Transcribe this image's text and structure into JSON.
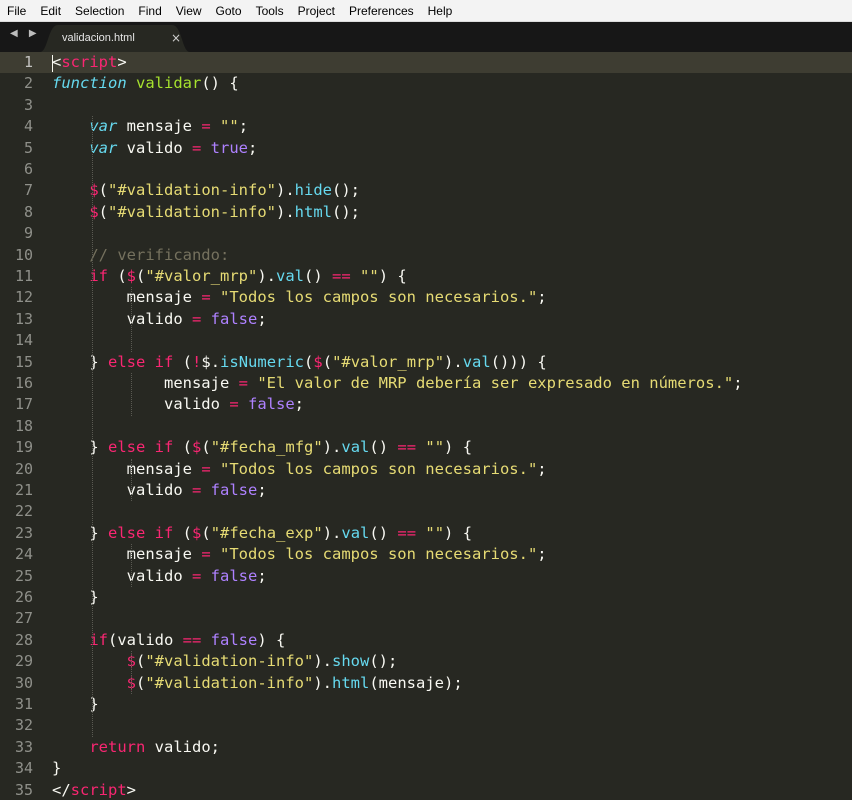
{
  "menu": [
    "File",
    "Edit",
    "Selection",
    "Find",
    "View",
    "Goto",
    "Tools",
    "Project",
    "Preferences",
    "Help"
  ],
  "tab": {
    "title": "validacion.html",
    "close": "×",
    "nav": "◀ ▶"
  },
  "colors": {
    "background": "#272822",
    "keyword": "#f92672",
    "storage": "#66d9ef",
    "function": "#a6e22e",
    "string": "#e6db74",
    "comment": "#75715e",
    "constant": "#ae81ff"
  },
  "editor": {
    "current_line": 1,
    "lines": [
      [
        [
          "p",
          "<"
        ],
        [
          "t",
          "script"
        ],
        [
          "p",
          ">"
        ]
      ],
      [
        [
          "st",
          "function"
        ],
        [
          "p",
          " "
        ],
        [
          "f",
          "validar"
        ],
        [
          "p",
          "() {"
        ]
      ],
      [],
      [
        [
          "p",
          "    "
        ],
        [
          "st",
          "var"
        ],
        [
          "p",
          " mensaje "
        ],
        [
          "k",
          "="
        ],
        [
          "p",
          " "
        ],
        [
          "s",
          "\"\""
        ],
        [
          "p",
          ";"
        ]
      ],
      [
        [
          "p",
          "    "
        ],
        [
          "st",
          "var"
        ],
        [
          "p",
          " valido "
        ],
        [
          "k",
          "="
        ],
        [
          "p",
          " "
        ],
        [
          "n",
          "true"
        ],
        [
          "p",
          ";"
        ]
      ],
      [],
      [
        [
          "p",
          "    "
        ],
        [
          "k",
          "$"
        ],
        [
          "p",
          "("
        ],
        [
          "s",
          "\"#validation-info\""
        ],
        [
          "p",
          ")."
        ],
        [
          "b",
          "hide"
        ],
        [
          "p",
          "();"
        ]
      ],
      [
        [
          "p",
          "    "
        ],
        [
          "k",
          "$"
        ],
        [
          "p",
          "("
        ],
        [
          "s",
          "\"#validation-info\""
        ],
        [
          "p",
          ")."
        ],
        [
          "b",
          "html"
        ],
        [
          "p",
          "();"
        ]
      ],
      [],
      [
        [
          "p",
          "    "
        ],
        [
          "c",
          "// verificando:"
        ]
      ],
      [
        [
          "p",
          "    "
        ],
        [
          "k",
          "if"
        ],
        [
          "p",
          " ("
        ],
        [
          "k",
          "$"
        ],
        [
          "p",
          "("
        ],
        [
          "s",
          "\"#valor_mrp\""
        ],
        [
          "p",
          ")."
        ],
        [
          "b",
          "val"
        ],
        [
          "p",
          "() "
        ],
        [
          "k",
          "=="
        ],
        [
          "p",
          " "
        ],
        [
          "s",
          "\"\""
        ],
        [
          "p",
          ") {"
        ]
      ],
      [
        [
          "p",
          "        mensaje "
        ],
        [
          "k",
          "="
        ],
        [
          "p",
          " "
        ],
        [
          "s",
          "\"Todos los campos son necesarios.\""
        ],
        [
          "p",
          ";"
        ]
      ],
      [
        [
          "p",
          "        valido "
        ],
        [
          "k",
          "="
        ],
        [
          "p",
          " "
        ],
        [
          "n",
          "false"
        ],
        [
          "p",
          ";"
        ]
      ],
      [],
      [
        [
          "p",
          "    } "
        ],
        [
          "k",
          "else"
        ],
        [
          "p",
          " "
        ],
        [
          "k",
          "if"
        ],
        [
          "p",
          " ("
        ],
        [
          "k",
          "!"
        ],
        [
          "p",
          "$."
        ],
        [
          "b",
          "isNumeric"
        ],
        [
          "p",
          "("
        ],
        [
          "k",
          "$"
        ],
        [
          "p",
          "("
        ],
        [
          "s",
          "\"#valor_mrp\""
        ],
        [
          "p",
          ")."
        ],
        [
          "b",
          "val"
        ],
        [
          "p",
          "())) {"
        ]
      ],
      [
        [
          "p",
          "            mensaje "
        ],
        [
          "k",
          "="
        ],
        [
          "p",
          " "
        ],
        [
          "s",
          "\"El valor de MRP debería ser expresado en números.\""
        ],
        [
          "p",
          ";"
        ]
      ],
      [
        [
          "p",
          "            valido "
        ],
        [
          "k",
          "="
        ],
        [
          "p",
          " "
        ],
        [
          "n",
          "false"
        ],
        [
          "p",
          ";"
        ]
      ],
      [],
      [
        [
          "p",
          "    } "
        ],
        [
          "k",
          "else"
        ],
        [
          "p",
          " "
        ],
        [
          "k",
          "if"
        ],
        [
          "p",
          " ("
        ],
        [
          "k",
          "$"
        ],
        [
          "p",
          "("
        ],
        [
          "s",
          "\"#fecha_mfg\""
        ],
        [
          "p",
          ")."
        ],
        [
          "b",
          "val"
        ],
        [
          "p",
          "() "
        ],
        [
          "k",
          "=="
        ],
        [
          "p",
          " "
        ],
        [
          "s",
          "\"\""
        ],
        [
          "p",
          ") {"
        ]
      ],
      [
        [
          "p",
          "        mensaje "
        ],
        [
          "k",
          "="
        ],
        [
          "p",
          " "
        ],
        [
          "s",
          "\"Todos los campos son necesarios.\""
        ],
        [
          "p",
          ";"
        ]
      ],
      [
        [
          "p",
          "        valido "
        ],
        [
          "k",
          "="
        ],
        [
          "p",
          " "
        ],
        [
          "n",
          "false"
        ],
        [
          "p",
          ";"
        ]
      ],
      [],
      [
        [
          "p",
          "    } "
        ],
        [
          "k",
          "else"
        ],
        [
          "p",
          " "
        ],
        [
          "k",
          "if"
        ],
        [
          "p",
          " ("
        ],
        [
          "k",
          "$"
        ],
        [
          "p",
          "("
        ],
        [
          "s",
          "\"#fecha_exp\""
        ],
        [
          "p",
          ")."
        ],
        [
          "b",
          "val"
        ],
        [
          "p",
          "() "
        ],
        [
          "k",
          "=="
        ],
        [
          "p",
          " "
        ],
        [
          "s",
          "\"\""
        ],
        [
          "p",
          ") {"
        ]
      ],
      [
        [
          "p",
          "        mensaje "
        ],
        [
          "k",
          "="
        ],
        [
          "p",
          " "
        ],
        [
          "s",
          "\"Todos los campos son necesarios.\""
        ],
        [
          "p",
          ";"
        ]
      ],
      [
        [
          "p",
          "        valido "
        ],
        [
          "k",
          "="
        ],
        [
          "p",
          " "
        ],
        [
          "n",
          "false"
        ],
        [
          "p",
          ";"
        ]
      ],
      [
        [
          "p",
          "    }"
        ]
      ],
      [],
      [
        [
          "p",
          "    "
        ],
        [
          "k",
          "if"
        ],
        [
          "p",
          "(valido "
        ],
        [
          "k",
          "=="
        ],
        [
          "p",
          " "
        ],
        [
          "n",
          "false"
        ],
        [
          "p",
          ") {"
        ]
      ],
      [
        [
          "p",
          "        "
        ],
        [
          "k",
          "$"
        ],
        [
          "p",
          "("
        ],
        [
          "s",
          "\"#validation-info\""
        ],
        [
          "p",
          ")."
        ],
        [
          "b",
          "show"
        ],
        [
          "p",
          "();"
        ]
      ],
      [
        [
          "p",
          "        "
        ],
        [
          "k",
          "$"
        ],
        [
          "p",
          "("
        ],
        [
          "s",
          "\"#validation-info\""
        ],
        [
          "p",
          ")."
        ],
        [
          "b",
          "html"
        ],
        [
          "p",
          "(mensaje);"
        ]
      ],
      [
        [
          "p",
          "    }"
        ]
      ],
      [],
      [
        [
          "p",
          "    "
        ],
        [
          "k",
          "return"
        ],
        [
          "p",
          " valido;"
        ]
      ],
      [
        [
          "p",
          "}"
        ]
      ],
      [
        [
          "p",
          "</"
        ],
        [
          "t",
          "script"
        ],
        [
          "p",
          ">"
        ]
      ]
    ]
  }
}
